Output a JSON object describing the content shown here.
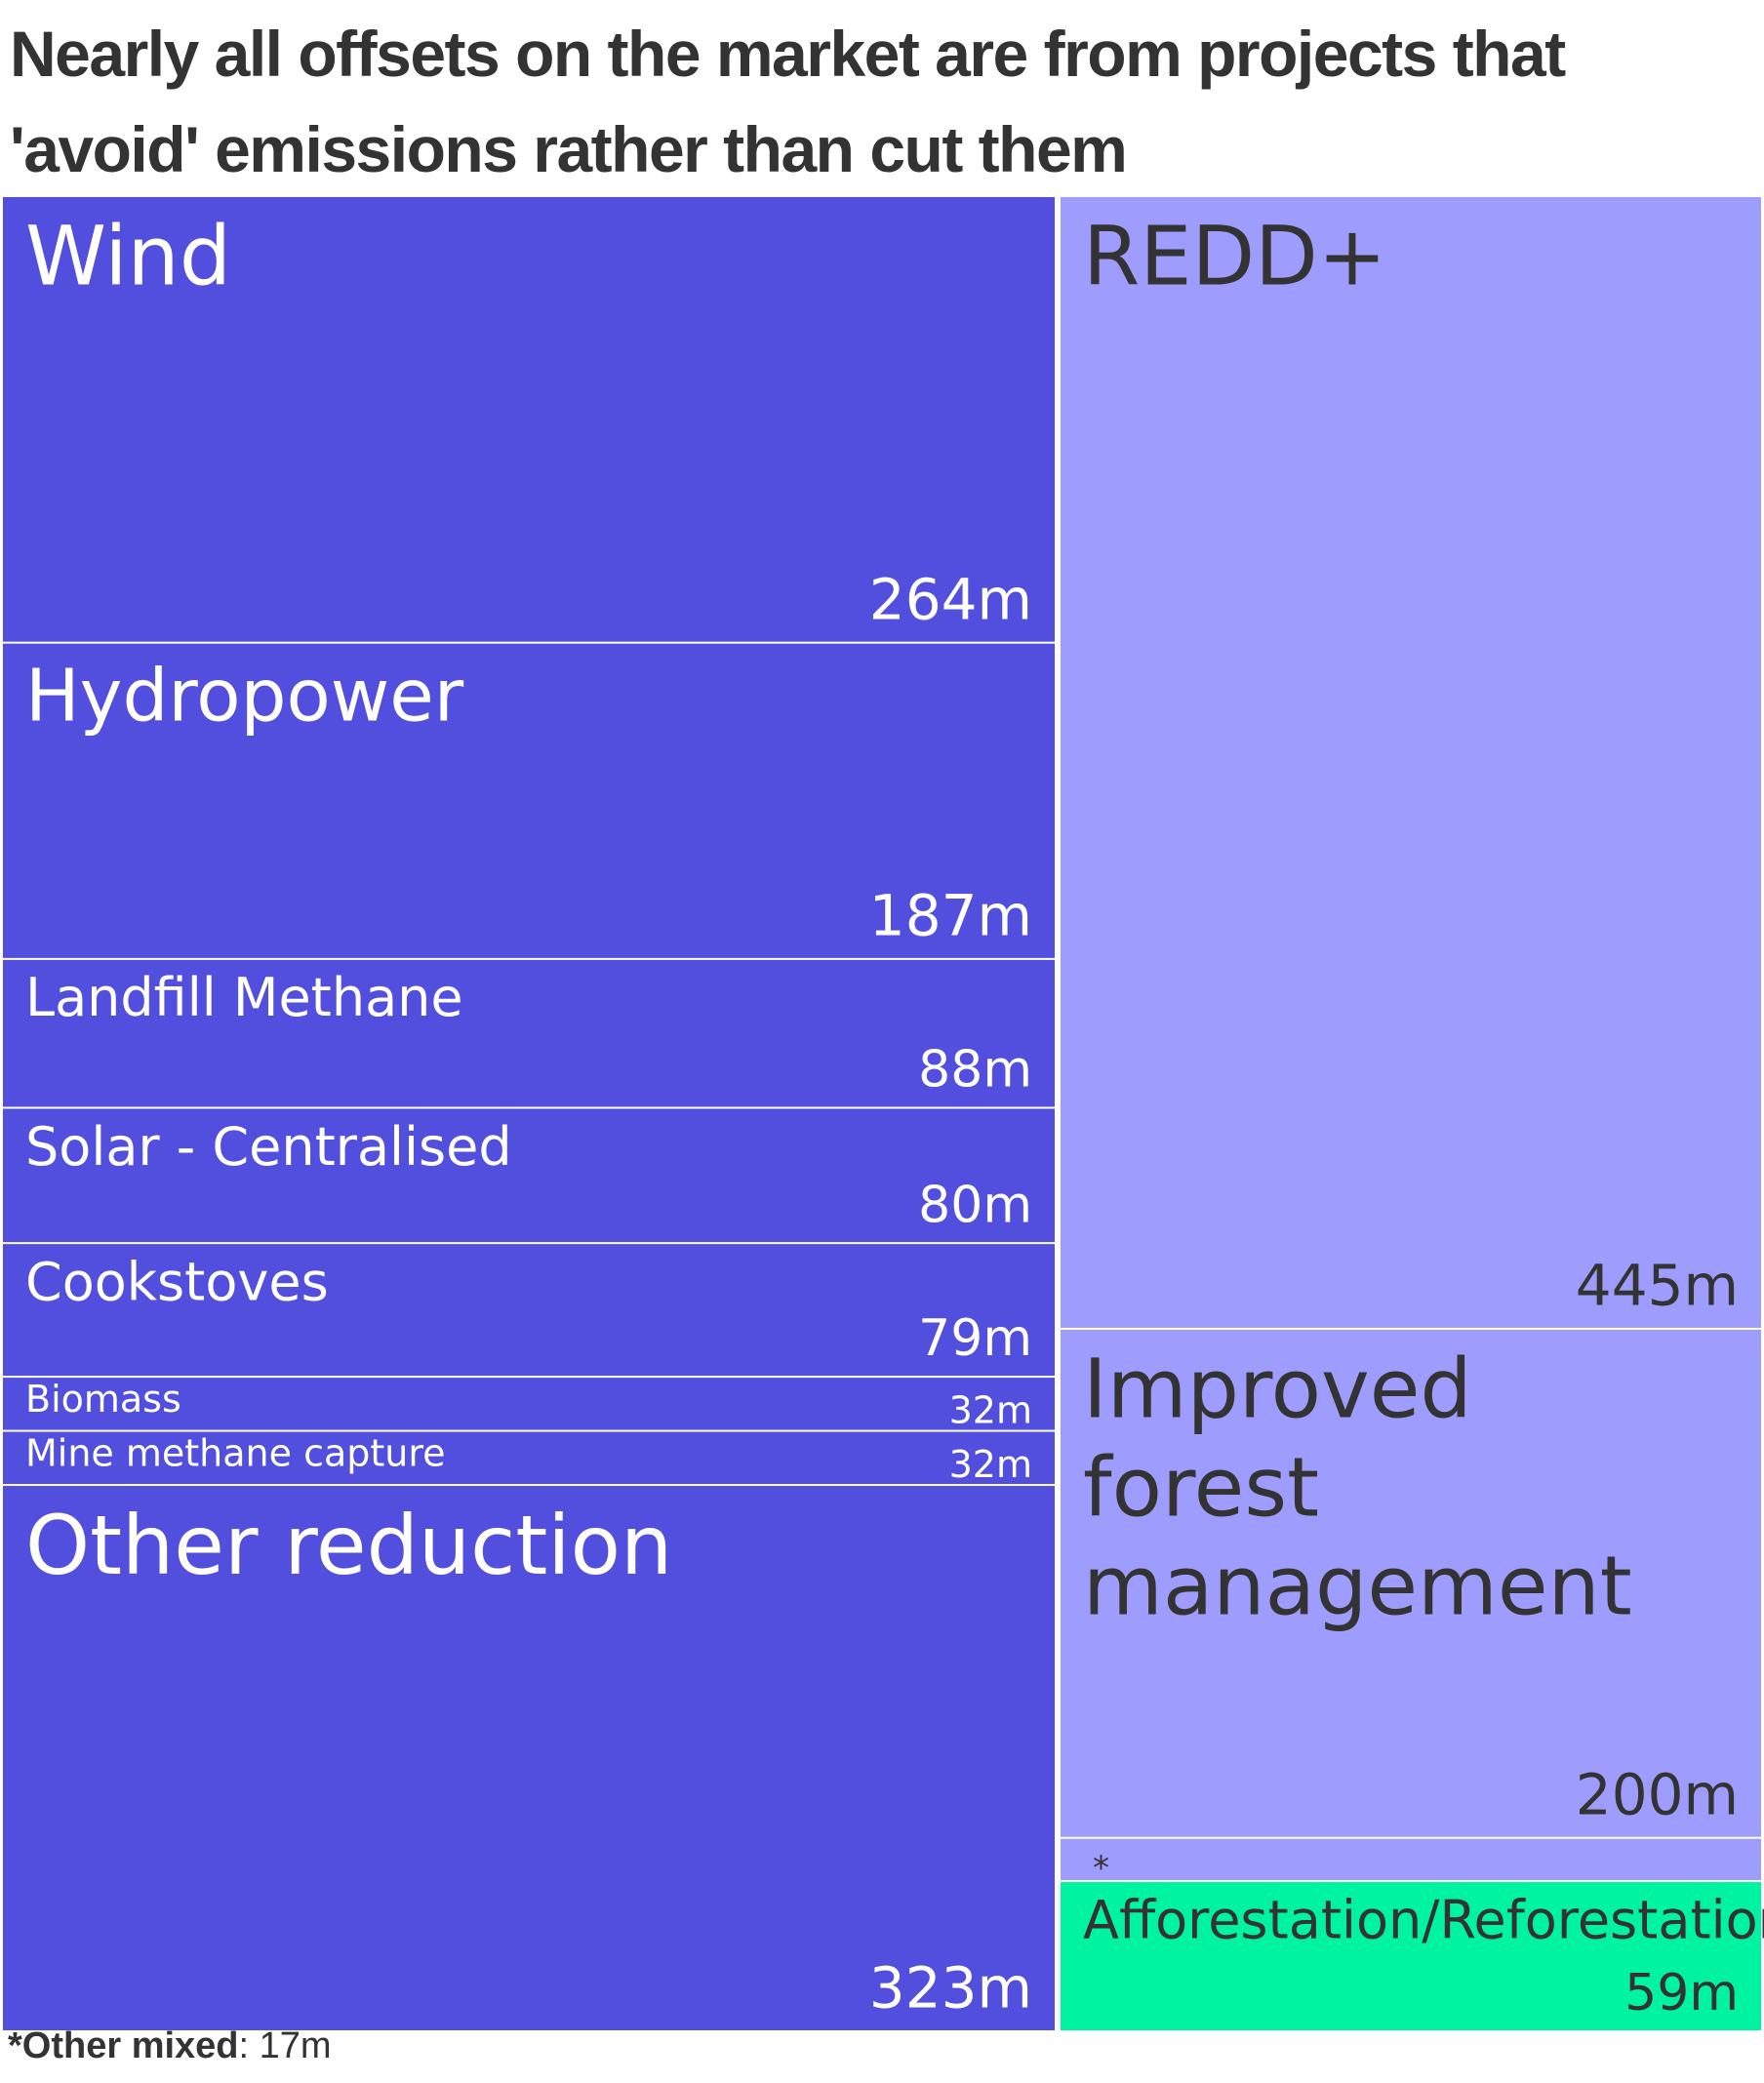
{
  "chart_data": {
    "type": "treemap",
    "title": "Nearly all offsets on the market are from projects that 'avoid' emissions rather than cut them",
    "unit": "m",
    "colors": {
      "reduction": "#524fdf",
      "forest": "#9e9cfd",
      "removal": "#00f3a0",
      "border": "#ffffff"
    },
    "groups": [
      {
        "color": "#524fdf",
        "items": [
          {
            "label": "Wind",
            "value": 264,
            "value_label": "264m"
          },
          {
            "label": "Hydropower",
            "value": 187,
            "value_label": "187m"
          },
          {
            "label": "Landfill Methane",
            "value": 88,
            "value_label": "88m"
          },
          {
            "label": "Solar - Centralised",
            "value": 80,
            "value_label": "80m"
          },
          {
            "label": "Cookstoves",
            "value": 79,
            "value_label": "79m"
          },
          {
            "label": "Biomass",
            "value": 32,
            "value_label": "32m"
          },
          {
            "label": "Mine methane capture",
            "value": 32,
            "value_label": "32m"
          },
          {
            "label": "Other reduction",
            "value": 323,
            "value_label": "323m"
          }
        ]
      },
      {
        "color": "#9e9cfd",
        "items": [
          {
            "label": "REDD+",
            "value": 445,
            "value_label": "445m"
          },
          {
            "label": "Improved forest management",
            "value": 200,
            "value_label": "200m"
          },
          {
            "label": "*",
            "value": 17,
            "value_label": ""
          }
        ]
      },
      {
        "color": "#00f3a0",
        "items": [
          {
            "label": "Afforestation/Reforestation",
            "value": 59,
            "value_label": "59m"
          }
        ]
      }
    ]
  },
  "footnote": {
    "label": "*Other mixed",
    "value": ": 17m"
  }
}
